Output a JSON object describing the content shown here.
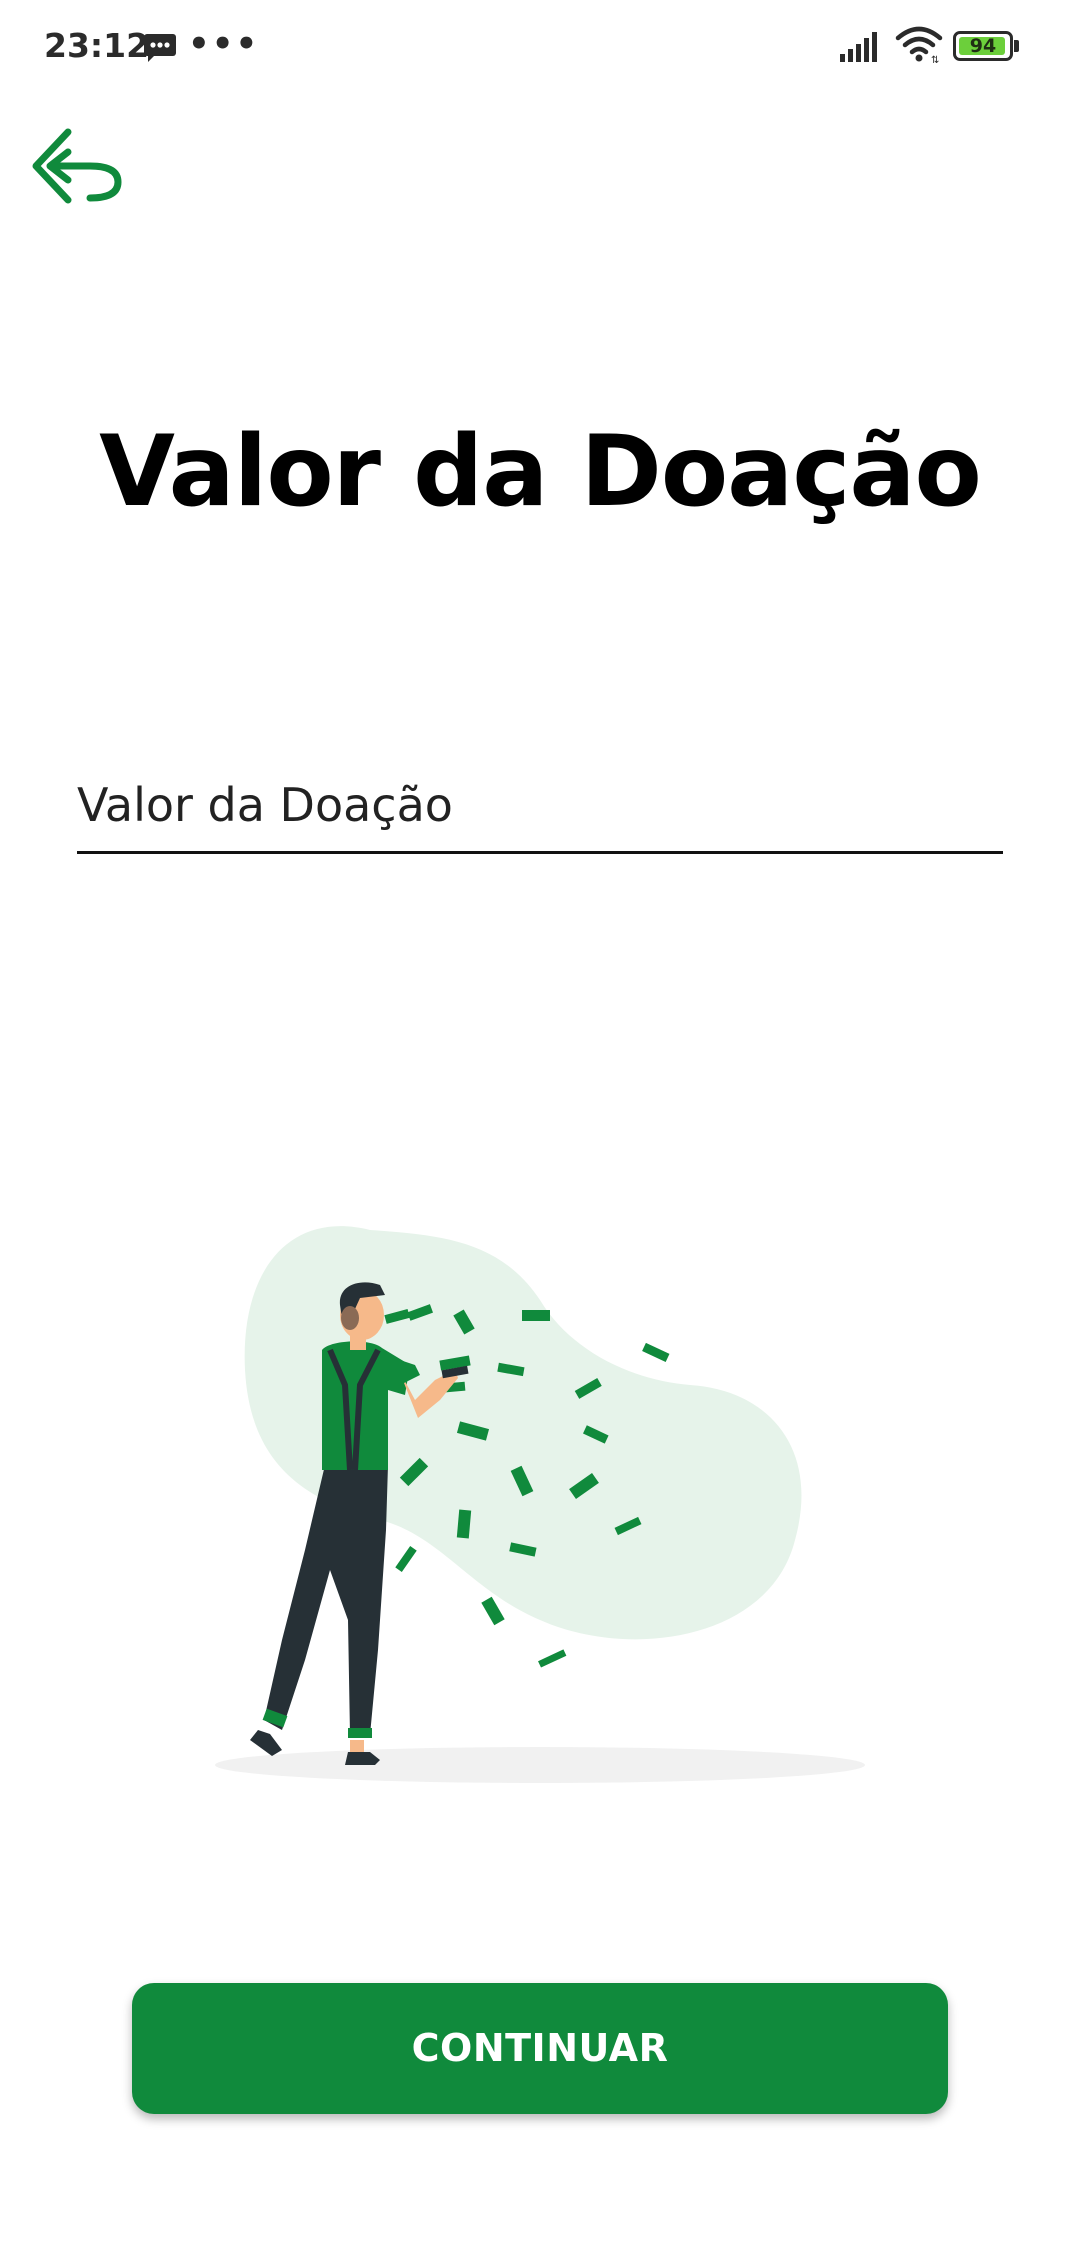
{
  "status_bar": {
    "time": "23:12",
    "dots": "•••",
    "battery_level": "94",
    "icons": [
      "message-icon",
      "signal-icon",
      "wifi-icon",
      "battery-icon"
    ]
  },
  "header": {
    "back_icon": "back-arrow-icon"
  },
  "page": {
    "title": "Valor da Doação"
  },
  "form": {
    "amount_placeholder": "Valor da Doação",
    "amount_value": ""
  },
  "illustration": {
    "subject": "person-throwing-money-illustration"
  },
  "actions": {
    "continue_label": "CONTINUAR"
  },
  "colors": {
    "brand_green": "#108a3c",
    "blob_green": "#e6f3ea",
    "text_dark": "#000000"
  }
}
